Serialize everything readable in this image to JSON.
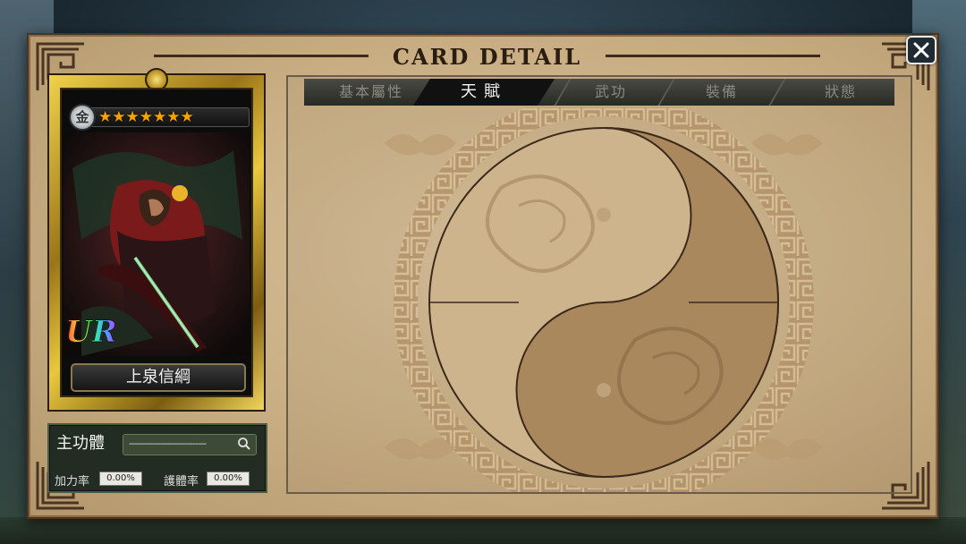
{
  "window": {
    "title": "CARD DETAIL",
    "close_icon": "close-icon"
  },
  "card": {
    "rank_glyph": "金",
    "stars": "★★★★★★★",
    "rarity": "UR",
    "name": "上泉信綱"
  },
  "stats": {
    "label": "主功體",
    "search_value": "-----------------------------",
    "power_rate_label": "加力率",
    "power_rate_value": "0.00%",
    "defense_rate_label": "護體率",
    "defense_rate_value": "0.00%"
  },
  "tabs": [
    {
      "label": "基本屬性",
      "active": false
    },
    {
      "label": "天賦",
      "active": true
    },
    {
      "label": "武功",
      "active": false
    },
    {
      "label": "裝備",
      "active": false
    },
    {
      "label": "狀態",
      "active": false
    }
  ],
  "colors": {
    "parchment": "#d9c29c",
    "gold": "#e9c83d",
    "star": "#f4a300",
    "active_tab": "#111111"
  }
}
